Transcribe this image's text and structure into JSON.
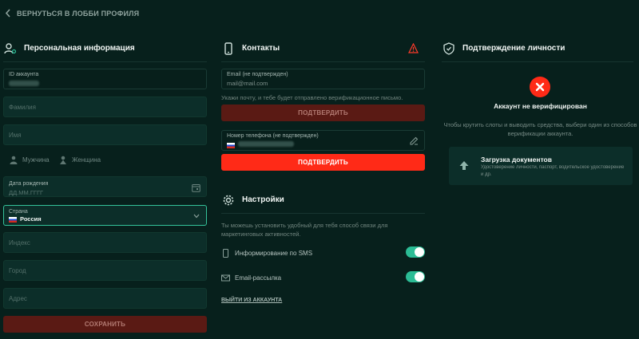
{
  "header": {
    "back_label": "ВЕРНУТЬСЯ В ЛОББИ ПРОФИЛЯ"
  },
  "personal": {
    "title": "Персональная информация",
    "account_id_label": "ID аккаунта",
    "lastname_placeholder": "Фамилия",
    "firstname_placeholder": "Имя",
    "gender_male": "Мужчина",
    "gender_female": "Женщина",
    "birthdate_label": "Дата рождения",
    "birthdate_placeholder": "ДД.ММ.ГГГГ",
    "country_label": "Страна",
    "country_value": "Россия",
    "index_placeholder": "Индекс",
    "city_placeholder": "Город",
    "address_placeholder": "Адрес",
    "save_label": "СОХРАНИТЬ"
  },
  "contacts": {
    "title": "Контакты",
    "email_label": "Email (не подтвержден)",
    "email_placeholder": "mail@mail.com",
    "email_hint": "Укажи почту, и тебе будет отправлено верификационное письмо.",
    "confirm_email_label": "ПОДТВЕРДИТЬ",
    "phone_label": "Номер телефона (не подтвержден)",
    "confirm_phone_label": "ПОДТВЕРДИТЬ"
  },
  "settings": {
    "title": "Настройки",
    "description": "Ты можешь установить удобный для тебя способ связи для маркетинговых активностей.",
    "sms_label": "Информирование по SMS",
    "email_label": "Email-рассылка",
    "logout_label": "ВЫЙТИ ИЗ АККАУНТА"
  },
  "verification": {
    "title": "Подтверждение личности",
    "status": "Аккаунт не верифицирован",
    "description": "Чтобы крутить слоты и выводить средства, выбери один из способов верификации аккаунта.",
    "upload_title": "Загрузка документов",
    "upload_desc": "Удостоверение личности, паспорт, водительское удостоверение и др."
  },
  "colors": {
    "accent": "#2bbc95",
    "danger": "#ff2a17",
    "background": "#07201c"
  }
}
